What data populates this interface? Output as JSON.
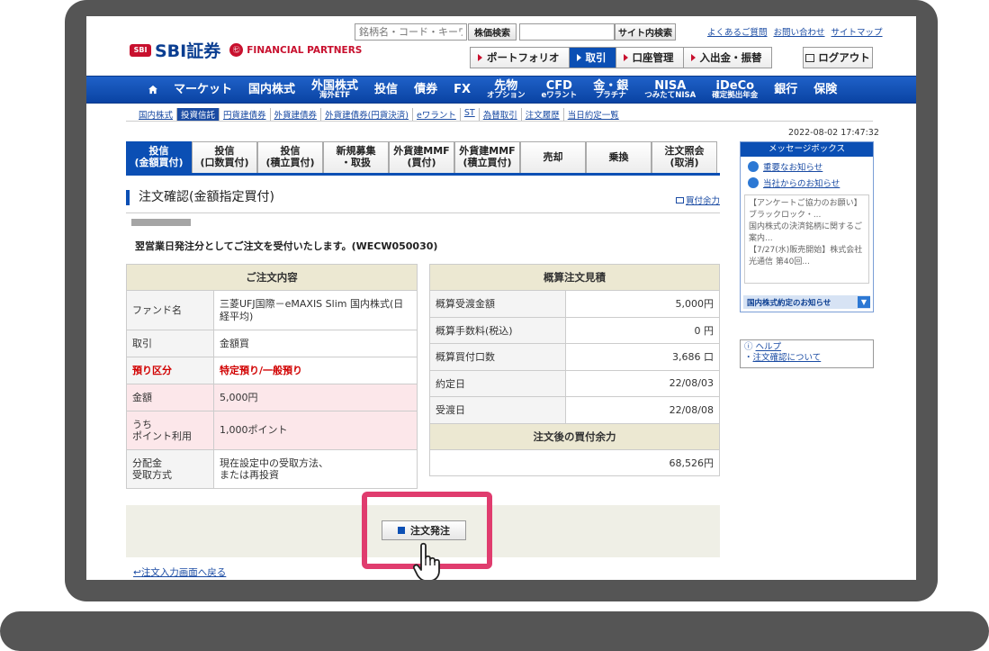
{
  "header": {
    "logo_mark": "SBI",
    "logo_text": "SBI証券",
    "fp_mark": "㊆",
    "fp_text": "FINANCIAL PARTNERS",
    "stock_search_placeholder": "銘柄名・コード・キーワ",
    "stock_search_button": "株価検索",
    "site_search_button": "サイト内検索",
    "top_links": [
      "よくあるご質問",
      "お問い合わせ",
      "サイトマップ"
    ],
    "mini_nav": [
      "ポートフォリオ",
      "取引",
      "口座管理",
      "入出金・振替"
    ],
    "logout": "ログアウト"
  },
  "main_nav": [
    {
      "label": "マーケット",
      "sub": ""
    },
    {
      "label": "国内株式",
      "sub": ""
    },
    {
      "label": "外国株式",
      "sub": "海外ETF"
    },
    {
      "label": "投信",
      "sub": ""
    },
    {
      "label": "債券",
      "sub": ""
    },
    {
      "label": "FX",
      "sub": ""
    },
    {
      "label": "先物",
      "sub": "オプション"
    },
    {
      "label": "CFD",
      "sub": "eワラント"
    },
    {
      "label": "金・銀",
      "sub": "プラチナ"
    },
    {
      "label": "NISA",
      "sub": "つみたてNISA"
    },
    {
      "label": "iDeCo",
      "sub": "確定拠出年金"
    },
    {
      "label": "銀行",
      "sub": ""
    },
    {
      "label": "保険",
      "sub": ""
    }
  ],
  "sub_nav": [
    "国内株式",
    "投資信託",
    "円貨建債券",
    "外貨建債券",
    "外貨建債券(円貨決済)",
    "eワラント",
    "ST",
    "為替取引",
    "注文履歴",
    "当日約定一覧"
  ],
  "timestamp": "2022-08-02 17:47:32",
  "tabs": [
    {
      "l1": "投信",
      "l2": "(金額買付)"
    },
    {
      "l1": "投信",
      "l2": "(口数買付)"
    },
    {
      "l1": "投信",
      "l2": "(積立買付)"
    },
    {
      "l1": "新規募集",
      "l2": "・取扱"
    },
    {
      "l1": "外貨建MMF",
      "l2": "(買付)"
    },
    {
      "l1": "外貨建MMF",
      "l2": "(積立買付)"
    },
    {
      "l1": "売却",
      "l2": ""
    },
    {
      "l1": "乗換",
      "l2": ""
    },
    {
      "l1": "注文照会",
      "l2": "(取消)"
    }
  ],
  "page_title": "注文確認(金額指定買付)",
  "buy_power_link": "買付余力",
  "message": "翌営業日発注分としてご注文を受付いたします。(WECW050030)",
  "order": {
    "header": "ご注文内容",
    "rows": [
      {
        "label": "ファンド名",
        "value": "三菱UFJ国際－eMAXIS Slim 国内株式(日経平均)"
      },
      {
        "label": "取引",
        "value": "金額買"
      },
      {
        "label": "預り区分",
        "value": "特定預り/一般預り"
      },
      {
        "label": "金額",
        "value": "5,000円"
      },
      {
        "label": "うち\nポイント利用",
        "value": "1,000ポイント"
      },
      {
        "label": "分配金\n受取方式",
        "value": "現在設定中の受取方法、\nまたは再投資"
      }
    ]
  },
  "estimate": {
    "header": "概算注文見積",
    "rows": [
      {
        "label": "概算受渡金額",
        "value": "5,000円"
      },
      {
        "label": "概算手数料(税込)",
        "value": "0 円"
      },
      {
        "label": "概算買付口数",
        "value": "3,686 口"
      },
      {
        "label": "約定日",
        "value": "22/08/03"
      },
      {
        "label": "受渡日",
        "value": "22/08/08"
      }
    ],
    "after_header": "注文後の買付余力",
    "after_value": "68,526円"
  },
  "submit_button": "注文発注",
  "back_link": "注文入力画面へ戻る",
  "message_box": {
    "title": "メッセージボックス",
    "links": [
      "重要なお知らせ",
      "当社からのお知らせ"
    ],
    "news": [
      "【アンケートご協力のお願い】ブラックロック・...",
      "国内株式の決済銘柄に関するご案内...",
      "【7/27(水)販売開始】株式会社光通信 第40回..."
    ],
    "footer": "国内株式約定のお知らせ"
  },
  "help": {
    "title": "ヘルプ",
    "link": "注文確認について"
  },
  "colors": {
    "brand_blue": "#0b4fb4",
    "highlight": "#e03c6e",
    "logo_red": "#c8102e"
  }
}
